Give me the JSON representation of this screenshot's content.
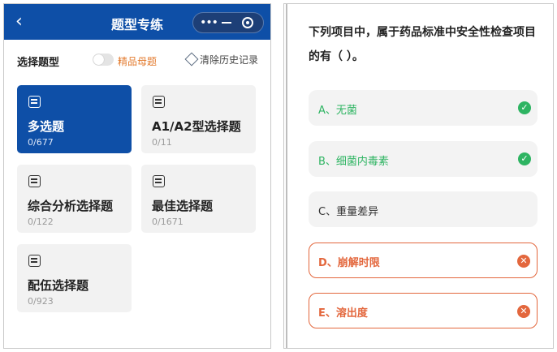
{
  "left_panel": {
    "header": {
      "back_glyph": "‹",
      "title": "题型专练",
      "more_glyph": "•••"
    },
    "toolbar": {
      "label": "选择题型",
      "toggle_text": "精品母题",
      "clear_text": "清除历史记录"
    },
    "cards": [
      {
        "title": "多选题",
        "count": "0/677",
        "selected": true
      },
      {
        "title": "A1/A2型选择题",
        "count": "0/11",
        "selected": false
      },
      {
        "title": "综合分析选择题",
        "count": "0/122",
        "selected": false
      },
      {
        "title": "最佳选择题",
        "count": "0/1671",
        "selected": false
      },
      {
        "title": "配伍选择题",
        "count": "0/923",
        "selected": false
      }
    ]
  },
  "right_panel": {
    "question": "下列项目中，属于药品标准中安全性检查项目的有（ ）。",
    "options": [
      {
        "text": "A、无菌",
        "state": "correct",
        "mark": "✓"
      },
      {
        "text": "B、细菌内毒素",
        "state": "correct",
        "mark": "✓"
      },
      {
        "text": "C、重量差异",
        "state": "neutral",
        "mark": ""
      },
      {
        "text": "D、崩解时限",
        "state": "wrong",
        "mark": "✕"
      },
      {
        "text": "E、溶出度",
        "state": "wrong",
        "mark": "✕"
      }
    ]
  },
  "colors": {
    "brand": "#0e4fa7",
    "correct": "#2eb462",
    "wrong": "#e3673d",
    "toggle_text": "#e37a2d"
  },
  "icons": [
    "back-arrow-icon",
    "more-dots-icon",
    "minimize-icon",
    "close-circle-icon",
    "eraser-icon",
    "question-list-icon",
    "check-icon",
    "cross-icon"
  ]
}
